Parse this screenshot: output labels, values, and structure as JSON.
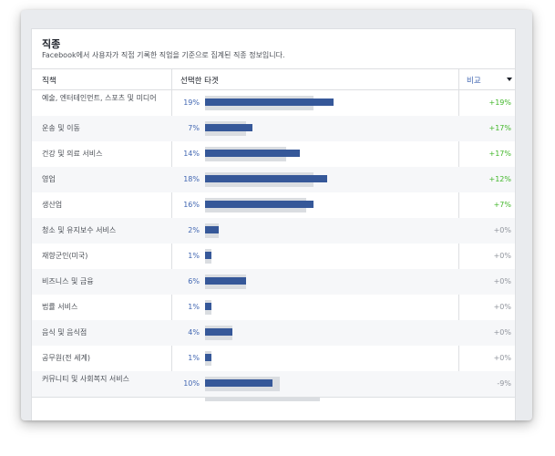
{
  "panel": {
    "title": "직종",
    "subtitle": "Facebook에서 사용자가 직접 기록한 직업을 기준으로 집계된 직종 정보입니다."
  },
  "columns": {
    "occupation": "직책",
    "selected": "선택한 타겟",
    "compare": "비교"
  },
  "colors": {
    "bar": "#365899",
    "benchmark_bar": "#dadde1",
    "positive": "#42b72a",
    "neutral": "#90949c",
    "link": "#4267b2"
  },
  "rows": [
    {
      "name": "예술, 엔터테인먼트, 스포츠 및 미디어",
      "pct": "19%",
      "diff": "+19%",
      "selected": 19,
      "benchmark": 16
    },
    {
      "name": "운송 및 이동",
      "pct": "7%",
      "diff": "+17%",
      "selected": 7,
      "benchmark": 6
    },
    {
      "name": "건강 및 의료 서비스",
      "pct": "14%",
      "diff": "+17%",
      "selected": 14,
      "benchmark": 12
    },
    {
      "name": "영업",
      "pct": "18%",
      "diff": "+12%",
      "selected": 18,
      "benchmark": 16
    },
    {
      "name": "생산업",
      "pct": "16%",
      "diff": "+7%",
      "selected": 16,
      "benchmark": 15
    },
    {
      "name": "청소 및 유지보수 서비스",
      "pct": "2%",
      "diff": "+0%",
      "selected": 2,
      "benchmark": 2
    },
    {
      "name": "재향군인(미국)",
      "pct": "1%",
      "diff": "+0%",
      "selected": 1,
      "benchmark": 1
    },
    {
      "name": "비즈니스 및 금융",
      "pct": "6%",
      "diff": "+0%",
      "selected": 6,
      "benchmark": 6
    },
    {
      "name": "법률 서비스",
      "pct": "1%",
      "diff": "+0%",
      "selected": 1,
      "benchmark": 1
    },
    {
      "name": "음식 및 음식점",
      "pct": "4%",
      "diff": "+0%",
      "selected": 4,
      "benchmark": 4
    },
    {
      "name": "공무원(전 세계)",
      "pct": "1%",
      "diff": "+0%",
      "selected": 1,
      "benchmark": 1
    },
    {
      "name": "커뮤니티 및 사회복지 서비스",
      "pct": "10%",
      "diff": "-9%",
      "selected": 10,
      "benchmark": 11
    }
  ],
  "scale_max_percent": 21
}
